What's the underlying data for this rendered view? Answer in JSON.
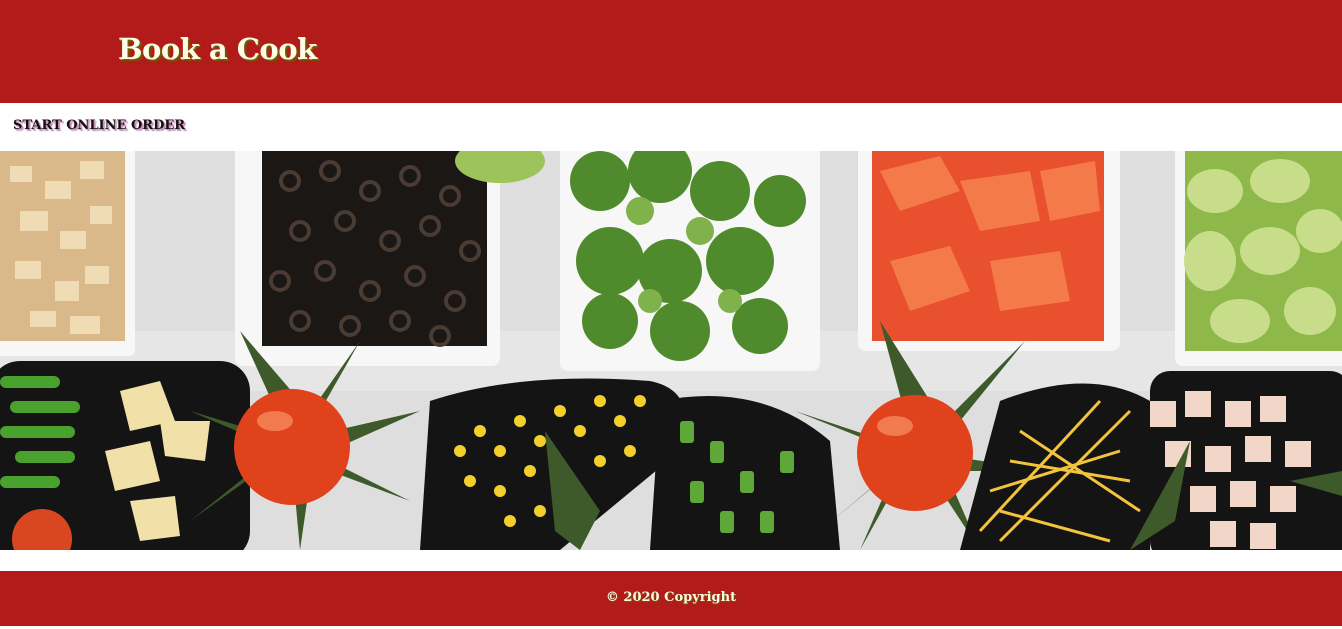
{
  "header": {
    "brand": "Book a Cook"
  },
  "nav": {
    "start_order": "START ONLINE ORDER"
  },
  "footer": {
    "copyright": "© 2020 Copyright"
  },
  "colors": {
    "brand_red": "#b31b1b",
    "brand_text": "#fffde8"
  }
}
